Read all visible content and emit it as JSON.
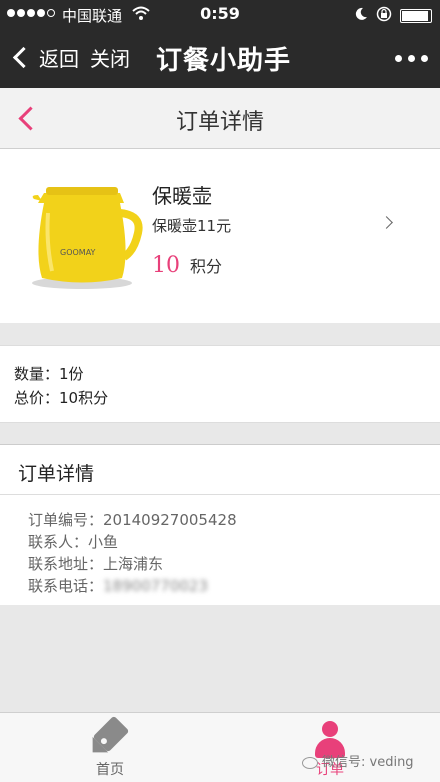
{
  "status_bar": {
    "carrier": "中国联通",
    "time": "0:59",
    "battery_level": 0.86
  },
  "nav_bar": {
    "back_label": "返回",
    "close_label": "关闭",
    "title": "订餐小助手"
  },
  "page_header": {
    "title": "订单详情"
  },
  "product": {
    "name": "保暖壶",
    "description": "保暖壶11元",
    "points_value": "10",
    "points_unit": "积分",
    "brand_text": "GOOMAY"
  },
  "summary": {
    "quantity": "数量：1份",
    "total": "总价：10积分"
  },
  "details": {
    "title": "订单详情",
    "order_number": "订单编号：20140927005428",
    "contact": "联系人：小鱼",
    "address": "联系地址：上海浦东",
    "phone_label": "联系电话：",
    "phone_value": "18900770023"
  },
  "tabbar": {
    "home": "首页",
    "order": "订单"
  },
  "watermark": "微信号: veding",
  "colors": {
    "accent": "#e8407a",
    "nav_bg": "#2a2a2a",
    "kettle": "#f2d21a"
  }
}
